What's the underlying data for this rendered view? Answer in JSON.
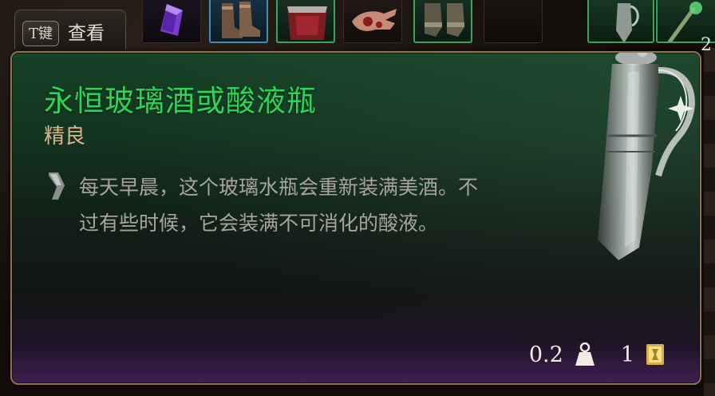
{
  "key_hint": {
    "key": "T键",
    "action": "查看"
  },
  "inventory": {
    "stack_count": "2"
  },
  "tooltip": {
    "title": "永恒玻璃酒或酸液瓶",
    "rarity": "精良",
    "description": "每天早晨，这个玻璃水瓶会重新装满美酒。不过有些时候，它会装满不可消化的酸液。",
    "weight": "0.2",
    "price": "1"
  },
  "colors": {
    "title_green": "#2ed458",
    "rarity_tan": "#d8b58d",
    "border_bronze": "#8b7456",
    "description_gray": "#a8a39b"
  },
  "icons": {
    "description_marker": "quill-marker-icon",
    "weight": "weight-icon",
    "price": "gold-coin-icon",
    "item_art": "pewter-decanter-icon"
  }
}
